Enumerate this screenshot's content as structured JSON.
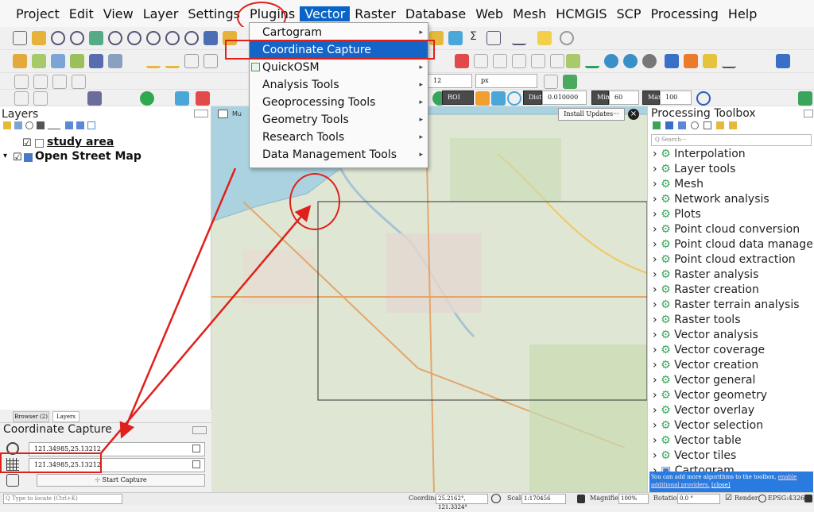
{
  "menubar": {
    "items": [
      "Project",
      "Edit",
      "View",
      "Layer",
      "Settings",
      "Plugins",
      "Vector",
      "Raster",
      "Database",
      "Web",
      "Mesh",
      "HCMGIS",
      "SCP",
      "Processing",
      "Help"
    ],
    "active": "Vector"
  },
  "vector_menu": {
    "items": [
      {
        "label": "Cartogram",
        "submenu": true,
        "highlighted": false
      },
      {
        "label": "Coordinate Capture",
        "submenu": false,
        "highlighted": true
      },
      {
        "label": "QuickOSM",
        "submenu": true,
        "highlighted": false
      },
      {
        "label": "Analysis Tools",
        "submenu": true,
        "highlighted": false
      },
      {
        "label": "Geoprocessing Tools",
        "submenu": true,
        "highlighted": false
      },
      {
        "label": "Geometry Tools",
        "submenu": true,
        "highlighted": false
      },
      {
        "label": "Research Tools",
        "submenu": true,
        "highlighted": false
      },
      {
        "label": "Data Management Tools",
        "submenu": true,
        "highlighted": false
      }
    ]
  },
  "toolbar": {
    "size_value": "12",
    "size_unit": "px",
    "roi_label": "ROI",
    "dist_label": "Dist",
    "dist_value": "0.010000",
    "min_label": "Min",
    "min_value": "60",
    "max_label": "Max",
    "max_value": "100"
  },
  "layers_panel": {
    "title": "Layers",
    "items": [
      {
        "label": "study area",
        "checked": true
      },
      {
        "label": "Open Street Map",
        "checked": true
      }
    ]
  },
  "map": {
    "install_updates_button": "Install Updates···",
    "tip_label": "Mu"
  },
  "bottom_tabs": [
    "Browser (2)",
    "Layers"
  ],
  "coordinate_capture": {
    "title": "Coordinate Capture",
    "value_1": "121.34985,25.13212",
    "value_2": "121.34985,25.13212",
    "start_button": "Start Capture"
  },
  "processing_toolbox": {
    "title": "Processing Toolbox",
    "search_placeholder": "Q Search···",
    "items": [
      "Interpolation",
      "Layer tools",
      "Mesh",
      "Network analysis",
      "Plots",
      "Point cloud conversion",
      "Point cloud data manage…",
      "Point cloud extraction",
      "Raster analysis",
      "Raster creation",
      "Raster terrain analysis",
      "Raster tools",
      "Vector analysis",
      "Vector coverage",
      "Vector creation",
      "Vector general",
      "Vector geometry",
      "Vector overlay",
      "Vector selection",
      "Vector table",
      "Vector tiles",
      "Cartogram"
    ],
    "info_text": "You can add more algorithms to the toolbox,",
    "info_link": "enable additional providers.",
    "info_close": "[close]"
  },
  "statusbar": {
    "locate_placeholder": "Q  Type to locate (Ctrl+K)",
    "coordinate_label": "Coordinate",
    "coordinate_value": "25.2162°, 121.3324°",
    "scale_label": "Scale",
    "scale_value": "1:170456",
    "magnifier_label": "Magnifier",
    "magnifier_value": "100%",
    "rotation_label": "Rotation",
    "rotation_value": "0.0 °",
    "render_label": "Render",
    "crs_label": "EPSG:4326"
  },
  "colors": {
    "accent": "#1565c8",
    "annotation_red": "#e0201a",
    "sea": "#aad3df",
    "land": "#dfe7d4"
  }
}
